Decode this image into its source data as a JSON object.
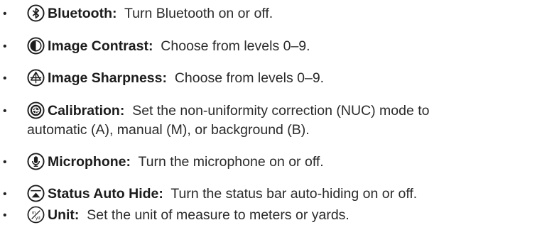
{
  "bullet_char": "•",
  "items": [
    {
      "icon": "bluetooth-icon",
      "term": "Bluetooth:",
      "description": "Turn Bluetooth on or off."
    },
    {
      "icon": "contrast-icon",
      "term": "Image Contrast:",
      "description": "Choose from levels 0–9."
    },
    {
      "icon": "sharpness-icon",
      "term": "Image Sharpness:",
      "description": "Choose from levels 0–9."
    },
    {
      "icon": "calibration-icon",
      "term": "Calibration:",
      "description": "Set the non-uniformity correction (NUC) mode to",
      "description_cont": "automatic (A), manual (M), or background (B)."
    },
    {
      "icon": "microphone-icon",
      "term": "Microphone:",
      "description": "Turn the microphone on or off."
    },
    {
      "icon": "status-auto-hide-icon",
      "term": "Status Auto Hide:",
      "description": "Turn the status bar auto-hiding on or off."
    },
    {
      "icon": "unit-icon",
      "term": "Unit:",
      "description": "Set the unit of measure to meters or yards."
    }
  ],
  "icon_glyphs": {
    "unit_top": "m",
    "unit_bottom": "yd"
  },
  "colors": {
    "text": "#222222",
    "icon_stroke": "#1c1c1c"
  }
}
